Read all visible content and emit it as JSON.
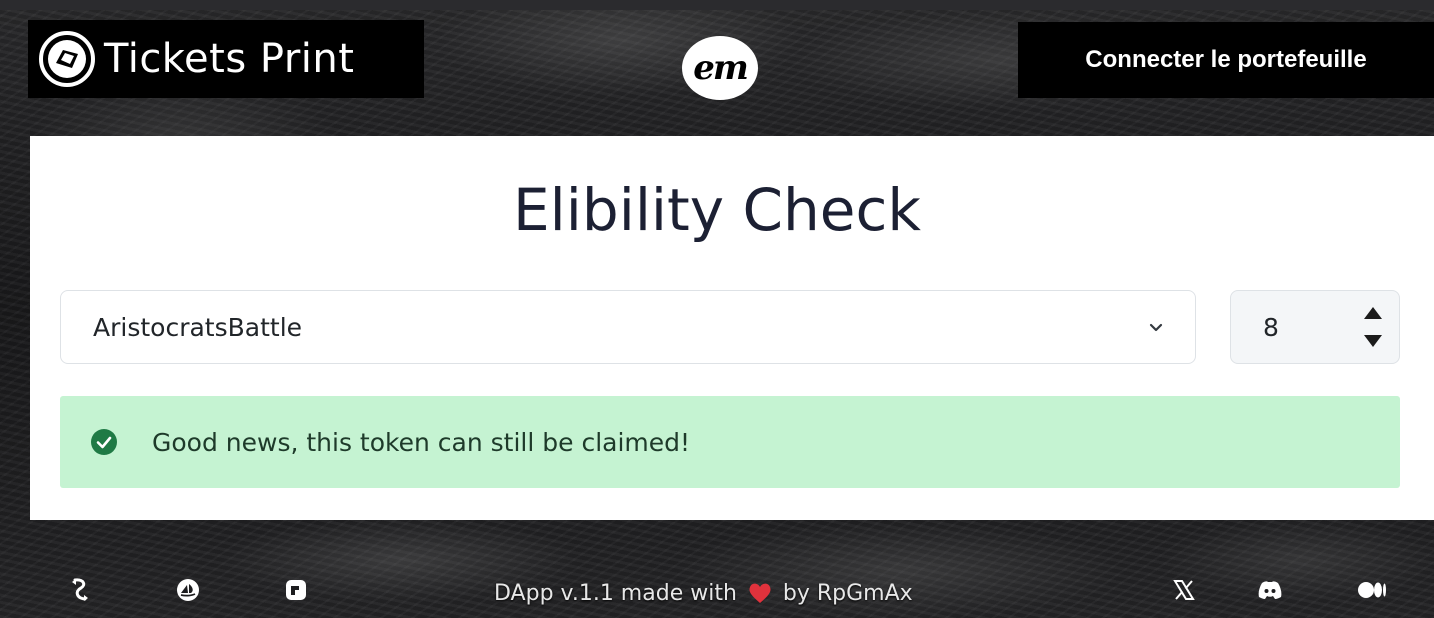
{
  "header": {
    "brand_title": "Tickets Print",
    "center_logo_text": "em",
    "connect_label": "Connecter le portefeuille"
  },
  "main": {
    "title": "Elibility Check",
    "collection_select": {
      "selected": "AristocratsBattle",
      "icon": "chevron-down-icon"
    },
    "token_input": {
      "value": "8"
    },
    "alert": {
      "status": "success",
      "message": "Good news, this token can still be claimed!",
      "color": "#c5f3d2",
      "icon_color": "#1f7a45"
    }
  },
  "footer": {
    "text_prefix": "DApp v.1.1 made with",
    "text_suffix": "by RpGmAx",
    "heart_color": "#e0323c",
    "left_icons": [
      "swap-icon",
      "opensea-icon",
      "marketplace-icon"
    ],
    "right_icons": [
      "x-twitter-icon",
      "discord-icon",
      "medium-icon"
    ]
  }
}
